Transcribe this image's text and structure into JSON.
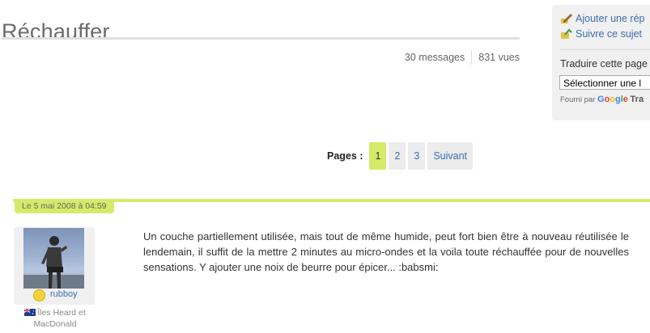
{
  "topic": {
    "title": "Réchauffer",
    "messages": "30 messages",
    "views": "831 vues"
  },
  "sidebar": {
    "reply_link": "Ajouter une rép",
    "follow_link": "Suivre ce sujet",
    "translate_label": "Traduire cette page",
    "translate_select": "Sélectionner une l",
    "powered_by": "Fourni par",
    "google": "Google",
    "translate_word": "Tra"
  },
  "pager": {
    "label": "Pages :",
    "pages": [
      "1",
      "2",
      "3"
    ],
    "next": "Suivant",
    "current": "1"
  },
  "post": {
    "date": "Le 5 mai 2008 à 04:59",
    "username": "rubboy",
    "location": "Îles Heard et MacDonald",
    "body": "Un couche partiellement utilisée, mais tout de même humide, peut fort bien être à nouveau réutilisée le lendemain, il suffit de la mettre 2 minutes au micro-ondes et la voila toute réchauffée pour de nouvelles sensations. Y ajouter une noix de beurre pour épicer... :babsmi:"
  },
  "colors": {
    "accent_green": "#d6ea6a",
    "link_blue": "#3a6fb0"
  }
}
